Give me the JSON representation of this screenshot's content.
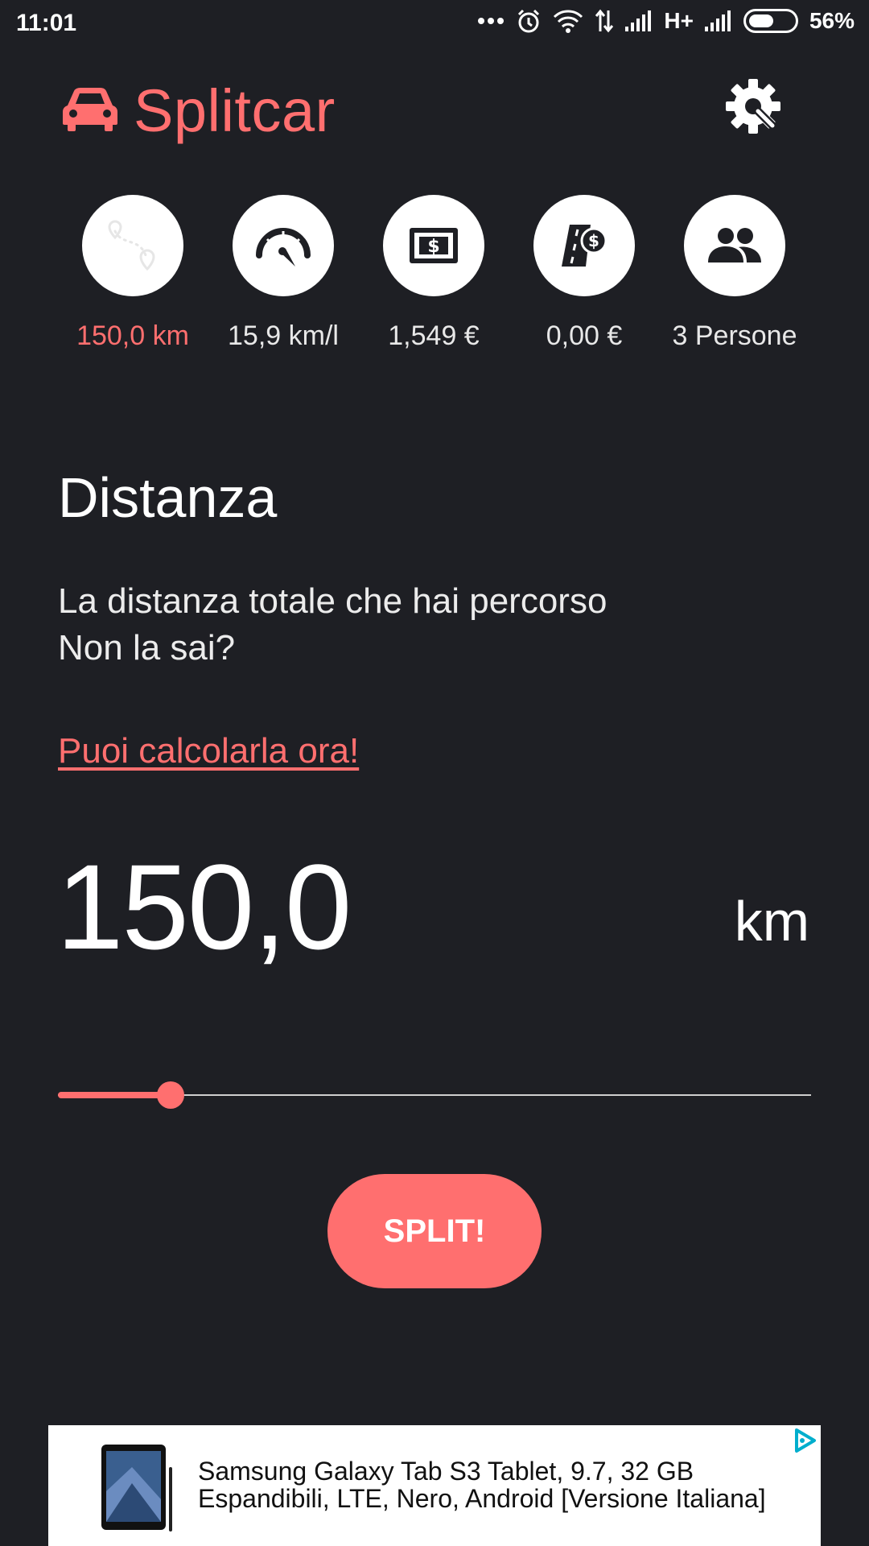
{
  "status_bar": {
    "time": "11:01",
    "network": "H+",
    "battery": "56%",
    "battery_level": 0.56
  },
  "header": {
    "title": "Splitcar",
    "logo_icon": "car-icon",
    "settings_icon": "gear-wrench-icon"
  },
  "stats": [
    {
      "icon": "route-icon",
      "label": "150,0 km",
      "active": true
    },
    {
      "icon": "speedometer-icon",
      "label": "15,9 km/l",
      "active": false
    },
    {
      "icon": "money-icon",
      "label": "1,549 €",
      "active": false
    },
    {
      "icon": "toll-road-icon",
      "label": "0,00 €",
      "active": false
    },
    {
      "icon": "people-icon",
      "label": "3 Persone",
      "active": false
    }
  ],
  "content": {
    "title": "Distanza",
    "description_line1": "La distanza totale che hai percorso",
    "description_line2": "Non la sai?",
    "link": "Puoi calcolarla ora!",
    "value": "150,0",
    "unit": "km",
    "slider_level": 0.15
  },
  "split_button": "SPLIT!",
  "ad": {
    "line1": "Samsung Galaxy Tab S3 Tablet, 9.7, 32 GB",
    "line2": "Espandibili, LTE, Nero, Android [Versione Italiana]"
  },
  "colors": {
    "accent": "#ff6f6f",
    "background": "#1e1f24",
    "ad_choice": "#00aecd"
  }
}
